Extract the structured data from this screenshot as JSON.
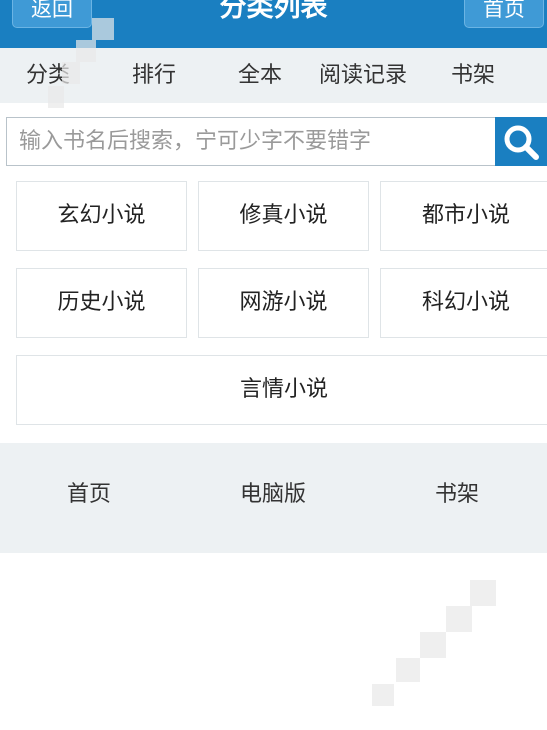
{
  "header": {
    "back_label": "返回",
    "title": "分类列表",
    "home_label": "首页"
  },
  "nav": {
    "items": [
      {
        "label": "分类"
      },
      {
        "label": "排行"
      },
      {
        "label": "全本"
      },
      {
        "label": "阅读记录"
      },
      {
        "label": "书架"
      }
    ]
  },
  "search": {
    "placeholder": "输入书名后搜索，宁可少字不要错字",
    "button_icon": "search-icon"
  },
  "categories": [
    {
      "label": "玄幻小说"
    },
    {
      "label": "修真小说"
    },
    {
      "label": "都市小说"
    },
    {
      "label": "历史小说"
    },
    {
      "label": "网游小说"
    },
    {
      "label": "科幻小说"
    },
    {
      "label": "言情小说"
    }
  ],
  "footer": {
    "items": [
      {
        "label": "首页"
      },
      {
        "label": "电脑版"
      },
      {
        "label": "书架"
      }
    ]
  },
  "colors": {
    "header_bg": "#1a7fc1",
    "nav_bg": "#edf1f3",
    "button_bg": "#3f9ad6"
  }
}
